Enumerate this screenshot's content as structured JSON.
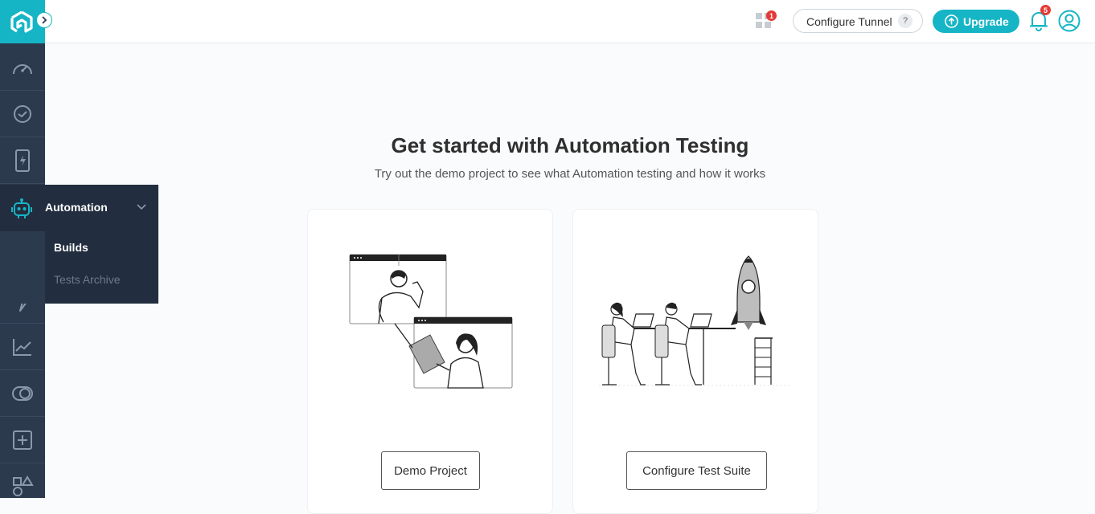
{
  "topbar": {
    "apps_badge": "1",
    "configure_tunnel_label": "Configure Tunnel",
    "help_label": "?",
    "upgrade_label": "Upgrade",
    "notifications_badge": "5"
  },
  "sidebar": {
    "flyout": {
      "title": "Automation",
      "items": [
        {
          "label": "Builds",
          "active": true
        },
        {
          "label": "Tests Archive",
          "active": false
        }
      ]
    }
  },
  "main": {
    "title": "Get started with Automation Testing",
    "subtitle": "Try out the demo project to see what Automation testing and how it works",
    "cards": [
      {
        "button_label": "Demo Project"
      },
      {
        "button_label": "Configure Test Suite"
      }
    ]
  },
  "colors": {
    "accent": "#16b5c6",
    "sidebar": "#2c3a4e",
    "flyout": "#222e3f",
    "badge": "#e53935"
  }
}
